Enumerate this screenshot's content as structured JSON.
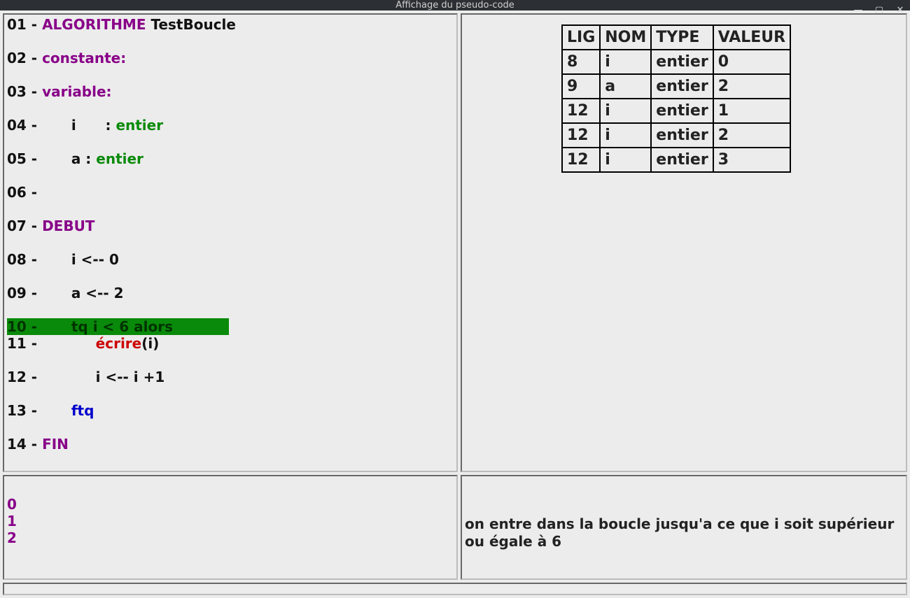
{
  "window": {
    "title": "Affichage du pseudo-code"
  },
  "code": {
    "lines": [
      {
        "n": "01 - ",
        "segs": [
          {
            "cls": "kw-purple",
            "t": "ALGORITHME"
          },
          {
            "cls": "txt",
            "t": " TestBoucle"
          }
        ]
      },
      {
        "n": "02 - ",
        "segs": [
          {
            "cls": "kw-purple",
            "t": "constante:"
          }
        ]
      },
      {
        "n": "03 - ",
        "segs": [
          {
            "cls": "kw-purple",
            "t": "variable:"
          }
        ]
      },
      {
        "n": "04 - ",
        "segs": [
          {
            "cls": "txt",
            "t": "      i      : "
          },
          {
            "cls": "kw-green",
            "t": "entier"
          }
        ]
      },
      {
        "n": "05 - ",
        "segs": [
          {
            "cls": "txt",
            "t": "      a : "
          },
          {
            "cls": "kw-green",
            "t": "entier"
          }
        ]
      },
      {
        "n": "06 - ",
        "segs": []
      },
      {
        "n": "07 - ",
        "segs": [
          {
            "cls": "kw-purple",
            "t": "DEBUT"
          }
        ]
      },
      {
        "n": "08 - ",
        "segs": [
          {
            "cls": "txt",
            "t": "      i <-- 0"
          }
        ]
      },
      {
        "n": "09 - ",
        "segs": [
          {
            "cls": "txt",
            "t": "      a <-- 2"
          }
        ]
      },
      {
        "n": "10 - ",
        "hl": true,
        "segs": [
          {
            "cls": "txt",
            "t": "      "
          },
          {
            "cls": "kw-blue",
            "t": "tq"
          },
          {
            "cls": "txt",
            "t": " i < 6 alors"
          }
        ]
      },
      {
        "n": "11 - ",
        "segs": [
          {
            "cls": "txt",
            "t": "           "
          },
          {
            "cls": "kw-red",
            "t": "écrire"
          },
          {
            "cls": "txt",
            "t": "(i)"
          }
        ]
      },
      {
        "n": "12 - ",
        "segs": [
          {
            "cls": "txt",
            "t": "           i <-- i +1"
          }
        ]
      },
      {
        "n": "13 - ",
        "segs": [
          {
            "cls": "txt",
            "t": "      "
          },
          {
            "cls": "kw-blue",
            "t": "ftq"
          }
        ]
      },
      {
        "n": "14 - ",
        "segs": [
          {
            "cls": "kw-purple",
            "t": "FIN"
          }
        ]
      }
    ]
  },
  "trace": {
    "headers": [
      "LIG",
      "NOM",
      "TYPE",
      "VALEUR"
    ],
    "rows": [
      [
        "8",
        "i",
        "entier",
        "0"
      ],
      [
        "9",
        "a",
        "entier",
        "2"
      ],
      [
        "12",
        "i",
        "entier",
        "1"
      ],
      [
        "12",
        "i",
        "entier",
        "2"
      ],
      [
        "12",
        "i",
        "entier",
        "3"
      ]
    ]
  },
  "output": {
    "lines": [
      "0",
      "1",
      "2"
    ]
  },
  "comment": {
    "text": "on entre dans la boucle jusqu'a ce que i soit supérieur ou égale à 6"
  }
}
